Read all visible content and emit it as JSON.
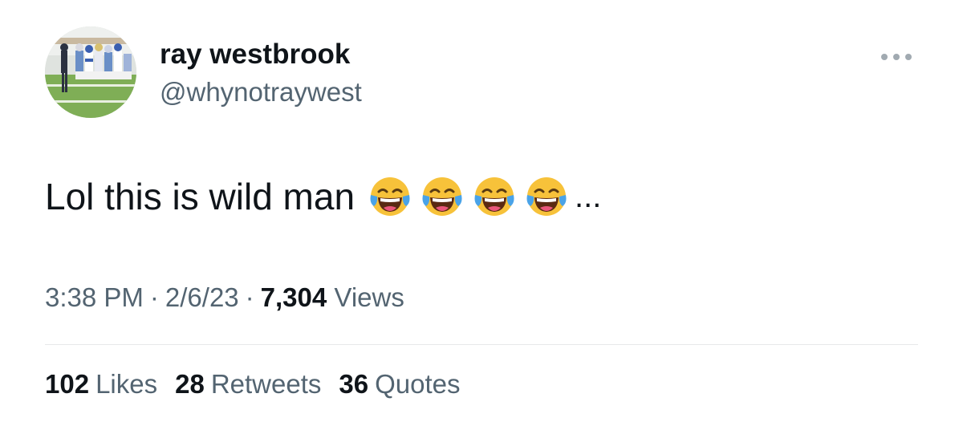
{
  "author": {
    "display_name": "ray westbrook",
    "handle": "@whynotraywest",
    "avatar_icon": "football-team-photo-avatar"
  },
  "more_icon": "more-horizontal-icon",
  "tweet": {
    "text": "Lol this is wild man",
    "emoji": [
      "face-with-tears-of-joy",
      "face-with-tears-of-joy",
      "face-with-tears-of-joy",
      "face-with-tears-of-joy"
    ],
    "truncation": "..."
  },
  "meta": {
    "time": "3:38 PM",
    "date": "2/6/23",
    "separator": "·",
    "views_count": "7,304",
    "views_label": "Views"
  },
  "stats": {
    "likes_count": "102",
    "likes_label": "Likes",
    "retweets_count": "28",
    "retweets_label": "Retweets",
    "quotes_count": "36",
    "quotes_label": "Quotes"
  },
  "colors": {
    "text_primary": "#0f1419",
    "text_secondary": "#536471",
    "divider": "#e7e9ea",
    "background": "#ffffff"
  }
}
